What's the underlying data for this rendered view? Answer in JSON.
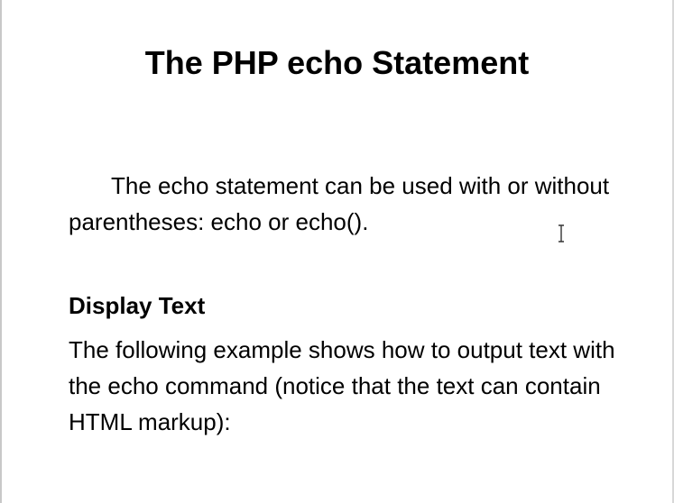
{
  "slide": {
    "title": "The PHP echo Statement",
    "intro": "The echo statement can be used with or without parentheses:  echo or echo().",
    "subheading": "Display Text",
    "body": "The following example shows how to output text with the echo command (notice that the text can contain HTML markup):"
  },
  "icons": {
    "cursor": "text-cursor-icon"
  }
}
